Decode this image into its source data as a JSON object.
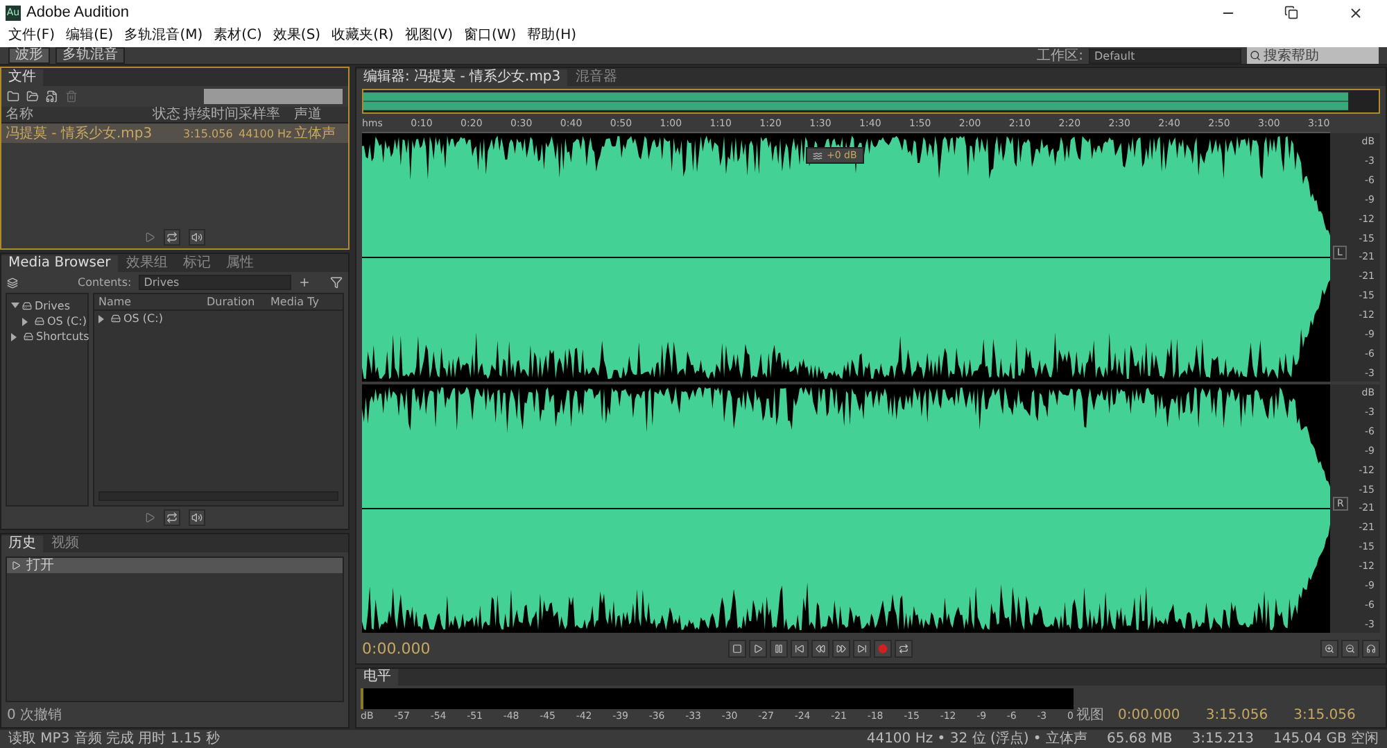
{
  "window": {
    "title": "Adobe Audition",
    "app_icon": "Au"
  },
  "menu": [
    "文件(F)",
    "编辑(E)",
    "多轨混音(M)",
    "素材(C)",
    "效果(S)",
    "收藏夹(R)",
    "视图(V)",
    "窗口(W)",
    "帮助(H)"
  ],
  "toolbar": {
    "modes": [
      {
        "label": "波形",
        "selected": true
      },
      {
        "label": "多轨混音",
        "selected": false
      }
    ],
    "workspace_label": "工作区:",
    "workspace": "Default",
    "search_placeholder": "搜索帮助"
  },
  "files_panel": {
    "tab": "文件",
    "columns": [
      "名称",
      "状态",
      "持续时间",
      "采样率",
      "声道"
    ],
    "rows": [
      {
        "name": "冯提莫 - 情系少女.mp3",
        "duration": "3:15.056",
        "sample_rate": "44100 Hz",
        "channels": "立体声",
        "selected": true
      }
    ]
  },
  "media_browser": {
    "tabs": [
      {
        "label": "Media Browser",
        "selected": true
      },
      {
        "label": "效果组",
        "selected": false
      },
      {
        "label": "标记",
        "selected": false
      },
      {
        "label": "属性",
        "selected": false
      }
    ],
    "contents_label": "Contents:",
    "contents": "Drives",
    "tree": [
      {
        "label": "Drives",
        "expanded": true,
        "children": [
          {
            "label": "OS (C:)",
            "expanded": false
          }
        ]
      },
      {
        "label": "Shortcuts",
        "expanded": false
      }
    ],
    "columns": [
      "Name",
      "Duration",
      "Media Ty"
    ],
    "items": [
      {
        "label": "OS (C:)",
        "expanded": false
      }
    ]
  },
  "history": {
    "tabs": [
      {
        "label": "历史",
        "selected": true
      },
      {
        "label": "视频",
        "selected": false
      }
    ],
    "items": [
      {
        "label": "打开",
        "selected": true
      }
    ],
    "undo_count": "0 次撤销"
  },
  "editor": {
    "tabs": [
      {
        "label": "编辑器: 冯提莫 - 情系少女.mp3",
        "selected": true
      },
      {
        "label": "混音器",
        "selected": false
      }
    ],
    "ruler": [
      "hms",
      "0:10",
      "0:20",
      "0:30",
      "0:40",
      "0:50",
      "1:00",
      "1:10",
      "1:20",
      "1:30",
      "1:40",
      "1:50",
      "2:00",
      "2:10",
      "2:20",
      "2:30",
      "2:40",
      "2:50",
      "3:00",
      "3:10"
    ],
    "hud": "+0 dB",
    "channels": [
      {
        "label": "L",
        "scale": [
          "dB",
          "-3",
          "-6",
          "-9",
          "-12",
          "-15",
          "-21",
          "-21",
          "-15",
          "-12",
          "-9",
          "-6",
          "-3"
        ]
      },
      {
        "label": "R",
        "scale": [
          "dB",
          "-3",
          "-6",
          "-9",
          "-12",
          "-15",
          "-21",
          "-21",
          "-15",
          "-12",
          "-9",
          "-6",
          "-3"
        ]
      }
    ],
    "time": "0:00.000"
  },
  "levels": {
    "tab": "电平",
    "scale": [
      "dB",
      "-57",
      "-54",
      "-51",
      "-48",
      "-45",
      "-42",
      "-39",
      "-36",
      "-33",
      "-30",
      "-27",
      "-24",
      "-21",
      "-18",
      "-15",
      "-12",
      "-9",
      "-6",
      "-3",
      "0"
    ]
  },
  "selection_view": {
    "rows": [
      {
        "label": "视图",
        "start": "0:00.000",
        "end": "3:15.056",
        "duration": "3:15.056"
      }
    ]
  },
  "status_bar": {
    "message": "读取 MP3 音频 完成 用时 1.15 秒",
    "items": [
      "44100 Hz • 32 位 (浮点) • 立体声",
      "65.68 MB",
      "3:15.213",
      "145.04 GB 空闲"
    ]
  }
}
